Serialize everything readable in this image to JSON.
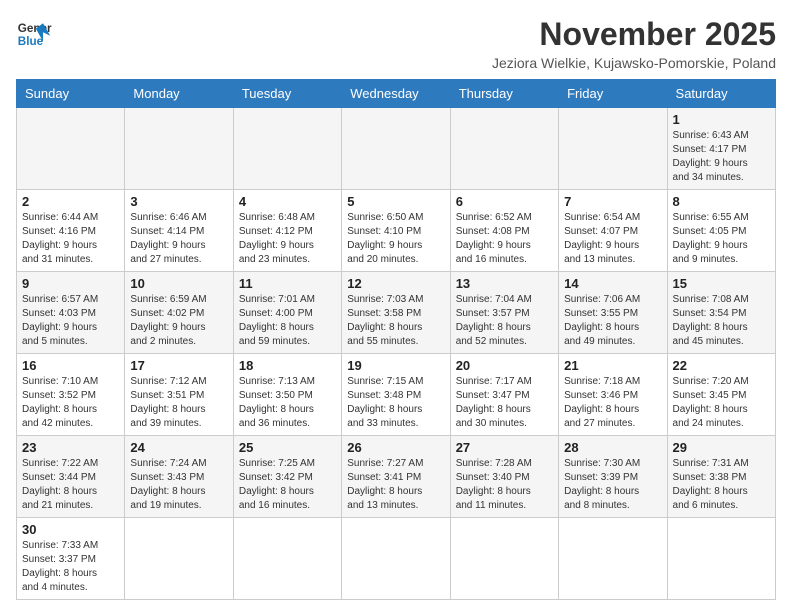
{
  "logo": {
    "text_general": "General",
    "text_blue": "Blue"
  },
  "header": {
    "title": "November 2025",
    "subtitle": "Jeziora Wielkie, Kujawsko-Pomorskie, Poland"
  },
  "weekdays": [
    "Sunday",
    "Monday",
    "Tuesday",
    "Wednesday",
    "Thursday",
    "Friday",
    "Saturday"
  ],
  "weeks": [
    [
      {
        "day": "",
        "info": ""
      },
      {
        "day": "",
        "info": ""
      },
      {
        "day": "",
        "info": ""
      },
      {
        "day": "",
        "info": ""
      },
      {
        "day": "",
        "info": ""
      },
      {
        "day": "",
        "info": ""
      },
      {
        "day": "1",
        "info": "Sunrise: 6:43 AM\nSunset: 4:17 PM\nDaylight: 9 hours\nand 34 minutes."
      }
    ],
    [
      {
        "day": "2",
        "info": "Sunrise: 6:44 AM\nSunset: 4:16 PM\nDaylight: 9 hours\nand 31 minutes."
      },
      {
        "day": "3",
        "info": "Sunrise: 6:46 AM\nSunset: 4:14 PM\nDaylight: 9 hours\nand 27 minutes."
      },
      {
        "day": "4",
        "info": "Sunrise: 6:48 AM\nSunset: 4:12 PM\nDaylight: 9 hours\nand 23 minutes."
      },
      {
        "day": "5",
        "info": "Sunrise: 6:50 AM\nSunset: 4:10 PM\nDaylight: 9 hours\nand 20 minutes."
      },
      {
        "day": "6",
        "info": "Sunrise: 6:52 AM\nSunset: 4:08 PM\nDaylight: 9 hours\nand 16 minutes."
      },
      {
        "day": "7",
        "info": "Sunrise: 6:54 AM\nSunset: 4:07 PM\nDaylight: 9 hours\nand 13 minutes."
      },
      {
        "day": "8",
        "info": "Sunrise: 6:55 AM\nSunset: 4:05 PM\nDaylight: 9 hours\nand 9 minutes."
      }
    ],
    [
      {
        "day": "9",
        "info": "Sunrise: 6:57 AM\nSunset: 4:03 PM\nDaylight: 9 hours\nand 5 minutes."
      },
      {
        "day": "10",
        "info": "Sunrise: 6:59 AM\nSunset: 4:02 PM\nDaylight: 9 hours\nand 2 minutes."
      },
      {
        "day": "11",
        "info": "Sunrise: 7:01 AM\nSunset: 4:00 PM\nDaylight: 8 hours\nand 59 minutes."
      },
      {
        "day": "12",
        "info": "Sunrise: 7:03 AM\nSunset: 3:58 PM\nDaylight: 8 hours\nand 55 minutes."
      },
      {
        "day": "13",
        "info": "Sunrise: 7:04 AM\nSunset: 3:57 PM\nDaylight: 8 hours\nand 52 minutes."
      },
      {
        "day": "14",
        "info": "Sunrise: 7:06 AM\nSunset: 3:55 PM\nDaylight: 8 hours\nand 49 minutes."
      },
      {
        "day": "15",
        "info": "Sunrise: 7:08 AM\nSunset: 3:54 PM\nDaylight: 8 hours\nand 45 minutes."
      }
    ],
    [
      {
        "day": "16",
        "info": "Sunrise: 7:10 AM\nSunset: 3:52 PM\nDaylight: 8 hours\nand 42 minutes."
      },
      {
        "day": "17",
        "info": "Sunrise: 7:12 AM\nSunset: 3:51 PM\nDaylight: 8 hours\nand 39 minutes."
      },
      {
        "day": "18",
        "info": "Sunrise: 7:13 AM\nSunset: 3:50 PM\nDaylight: 8 hours\nand 36 minutes."
      },
      {
        "day": "19",
        "info": "Sunrise: 7:15 AM\nSunset: 3:48 PM\nDaylight: 8 hours\nand 33 minutes."
      },
      {
        "day": "20",
        "info": "Sunrise: 7:17 AM\nSunset: 3:47 PM\nDaylight: 8 hours\nand 30 minutes."
      },
      {
        "day": "21",
        "info": "Sunrise: 7:18 AM\nSunset: 3:46 PM\nDaylight: 8 hours\nand 27 minutes."
      },
      {
        "day": "22",
        "info": "Sunrise: 7:20 AM\nSunset: 3:45 PM\nDaylight: 8 hours\nand 24 minutes."
      }
    ],
    [
      {
        "day": "23",
        "info": "Sunrise: 7:22 AM\nSunset: 3:44 PM\nDaylight: 8 hours\nand 21 minutes."
      },
      {
        "day": "24",
        "info": "Sunrise: 7:24 AM\nSunset: 3:43 PM\nDaylight: 8 hours\nand 19 minutes."
      },
      {
        "day": "25",
        "info": "Sunrise: 7:25 AM\nSunset: 3:42 PM\nDaylight: 8 hours\nand 16 minutes."
      },
      {
        "day": "26",
        "info": "Sunrise: 7:27 AM\nSunset: 3:41 PM\nDaylight: 8 hours\nand 13 minutes."
      },
      {
        "day": "27",
        "info": "Sunrise: 7:28 AM\nSunset: 3:40 PM\nDaylight: 8 hours\nand 11 minutes."
      },
      {
        "day": "28",
        "info": "Sunrise: 7:30 AM\nSunset: 3:39 PM\nDaylight: 8 hours\nand 8 minutes."
      },
      {
        "day": "29",
        "info": "Sunrise: 7:31 AM\nSunset: 3:38 PM\nDaylight: 8 hours\nand 6 minutes."
      }
    ],
    [
      {
        "day": "30",
        "info": "Sunrise: 7:33 AM\nSunset: 3:37 PM\nDaylight: 8 hours\nand 4 minutes."
      },
      {
        "day": "",
        "info": ""
      },
      {
        "day": "",
        "info": ""
      },
      {
        "day": "",
        "info": ""
      },
      {
        "day": "",
        "info": ""
      },
      {
        "day": "",
        "info": ""
      },
      {
        "day": "",
        "info": ""
      }
    ]
  ]
}
